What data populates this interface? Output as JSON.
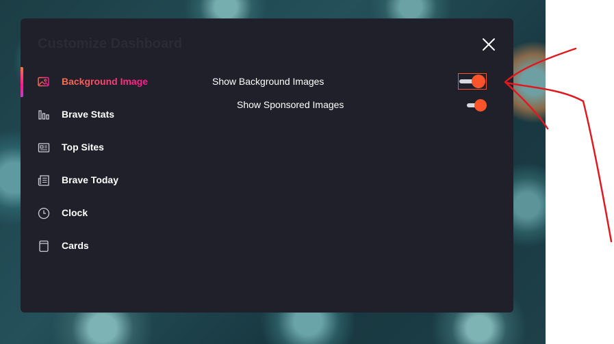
{
  "dialog": {
    "title": "Customize Dashboard"
  },
  "sidebar": {
    "items": [
      {
        "label": "Background Image",
        "icon": "image-icon",
        "active": true
      },
      {
        "label": "Brave Stats",
        "icon": "bar-chart-icon",
        "active": false
      },
      {
        "label": "Top Sites",
        "icon": "top-sites-icon",
        "active": false
      },
      {
        "label": "Brave Today",
        "icon": "newspaper-icon",
        "active": false
      },
      {
        "label": "Clock",
        "icon": "clock-icon",
        "active": false
      },
      {
        "label": "Cards",
        "icon": "cards-icon",
        "active": false
      }
    ]
  },
  "settings": {
    "show_background_images": {
      "label": "Show Background Images",
      "enabled": true
    },
    "show_sponsored_images": {
      "label": "Show Sponsored Images",
      "enabled": true
    }
  },
  "colors": {
    "dialog_bg": "#1f2029",
    "accent": "#fb542b",
    "active_gradient_start": "#fa7250",
    "active_gradient_end": "#ff1893",
    "annotation_red": "#e0191f"
  }
}
